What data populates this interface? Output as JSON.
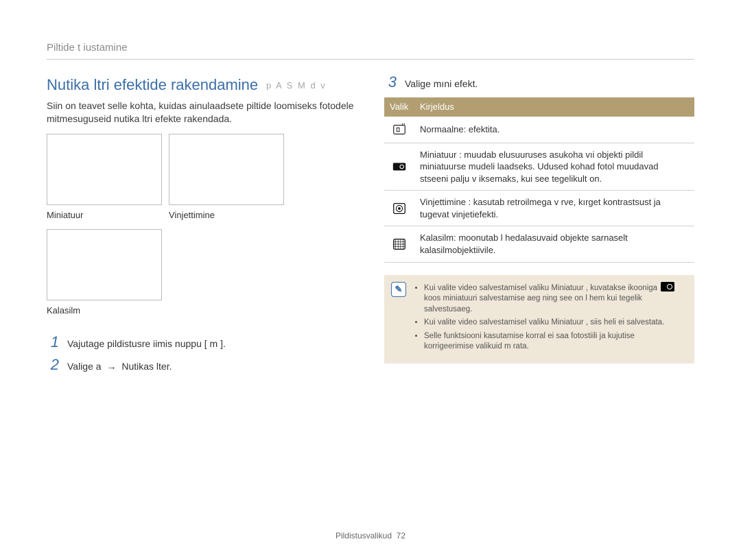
{
  "breadcrumb": "Piltide t iustamine",
  "title": "Nutika   ltri efektide rakendamine",
  "modes": "p A S M d v",
  "intro": "Siin on teavet selle kohta, kuidas ainulaadsete piltide loomiseks fotodele mitmesuguseid nutika  ltri efekte rakendada.",
  "thumbs": [
    {
      "label": "Miniatuur"
    },
    {
      "label": "Vinjettimine"
    },
    {
      "label": "Kalasilm"
    }
  ],
  "steps": {
    "s1": {
      "num": "1",
      "text": "Vajutage pildistusre iimis nuppu [ m       ]."
    },
    "s2": {
      "num": "2",
      "prefix": "Valige a ",
      "arrow": "→",
      "path": "Nutikas   lter",
      "suffix": "."
    },
    "s3": {
      "num": "3",
      "text": "Valige mıni efekt."
    }
  },
  "table": {
    "headers": {
      "option": "Valik",
      "desc": "Kirjeldus"
    },
    "rows": [
      {
        "icon": "normal-icon",
        "desc": "Normaalne: efektita."
      },
      {
        "icon": "miniature-icon",
        "desc": "Miniatuur : muudab elusuuruses asukoha vıi objekti pildil miniatuurse mudeli laadseks. Udused kohad fotol muudavad stseeni palju v iksemaks, kui see tegelikult on."
      },
      {
        "icon": "vignette-icon",
        "desc": "Vinjettimine : kasutab retroilmega v rve, kırget kontrastsust ja tugevat vinjetiefekti."
      },
      {
        "icon": "fisheye-icon",
        "desc": "Kalasilm: moonutab l hedalasuvaid objekte sarnaselt kalasilmobjektiivile."
      }
    ]
  },
  "note": {
    "items": [
      "Kui valite video salvestamisel valiku Miniatuur , kuvatakse ikooniga __ICON__ koos miniatuuri salvestamise aeg ning see on l hem kui tegelik salvestusaeg.",
      "Kui valite video salvestamisel valiku Miniatuur , siis heli ei salvestata.",
      "Selle funktsiooni kasutamise korral ei saa fotostiili ja kujutise korrigeerimise valikuid m  rata."
    ]
  },
  "footer": {
    "section": "Pildistusvalikud",
    "page": "72"
  }
}
